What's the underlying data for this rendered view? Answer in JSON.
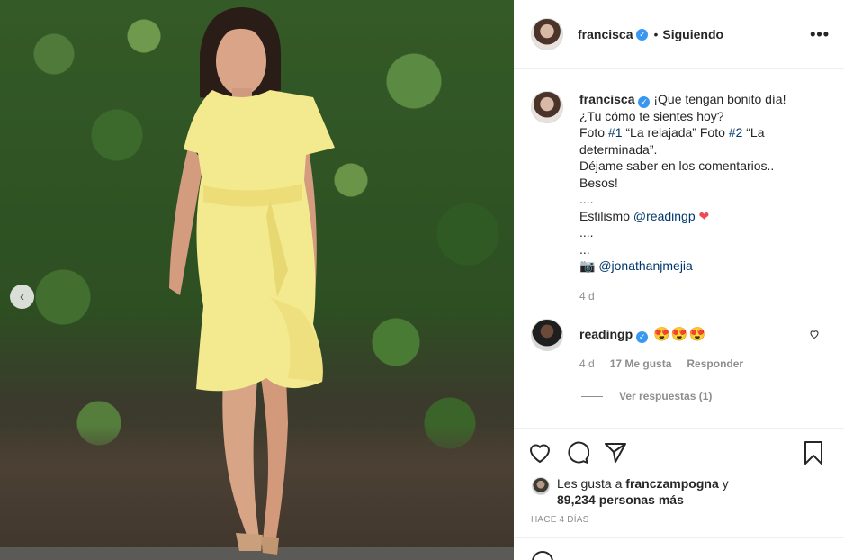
{
  "post": {
    "author": "francisca",
    "follow_status": "Siguiendo",
    "more_label": "•••"
  },
  "photo": {
    "prev_arrow": "‹"
  },
  "caption": {
    "author": "francisca",
    "line1": "¡Que tengan bonito día!",
    "line2": "¿Tu cómo te sientes hoy?",
    "foto_1_prefix": "Foto ",
    "foto_1_tag": "#1",
    "foto_1_text": " “La relajada” Foto ",
    "foto_2_tag": "#2",
    "foto_2_text": " “La determinada”.",
    "line4": "Déjame saber en los comentarios..",
    "line5": "Besos!",
    "dots1": "....",
    "styling_label": "Estilismo ",
    "styling_mention": "@readingp",
    "heart": "❤",
    "dots2": "....",
    "dots3": "...",
    "camera": "📷",
    "photo_mention": "@jonathanjmejia",
    "time": "4 d"
  },
  "comment": {
    "author": "readingp",
    "text": "😍😍😍",
    "time": "4 d",
    "likes": "17 Me gusta",
    "reply_label": "Responder",
    "view_replies": "Ver respuestas (1)"
  },
  "likes": {
    "prefix": "Les gusta a ",
    "user": "franczampogna",
    "joiner": " y",
    "others": "89,234 personas más"
  },
  "posted_ago": "HACE 4 DÍAS",
  "colors": {
    "link": "#00376b",
    "verified": "#3897f0",
    "muted": "#8e8e8e",
    "dress": "#f3e98f"
  }
}
